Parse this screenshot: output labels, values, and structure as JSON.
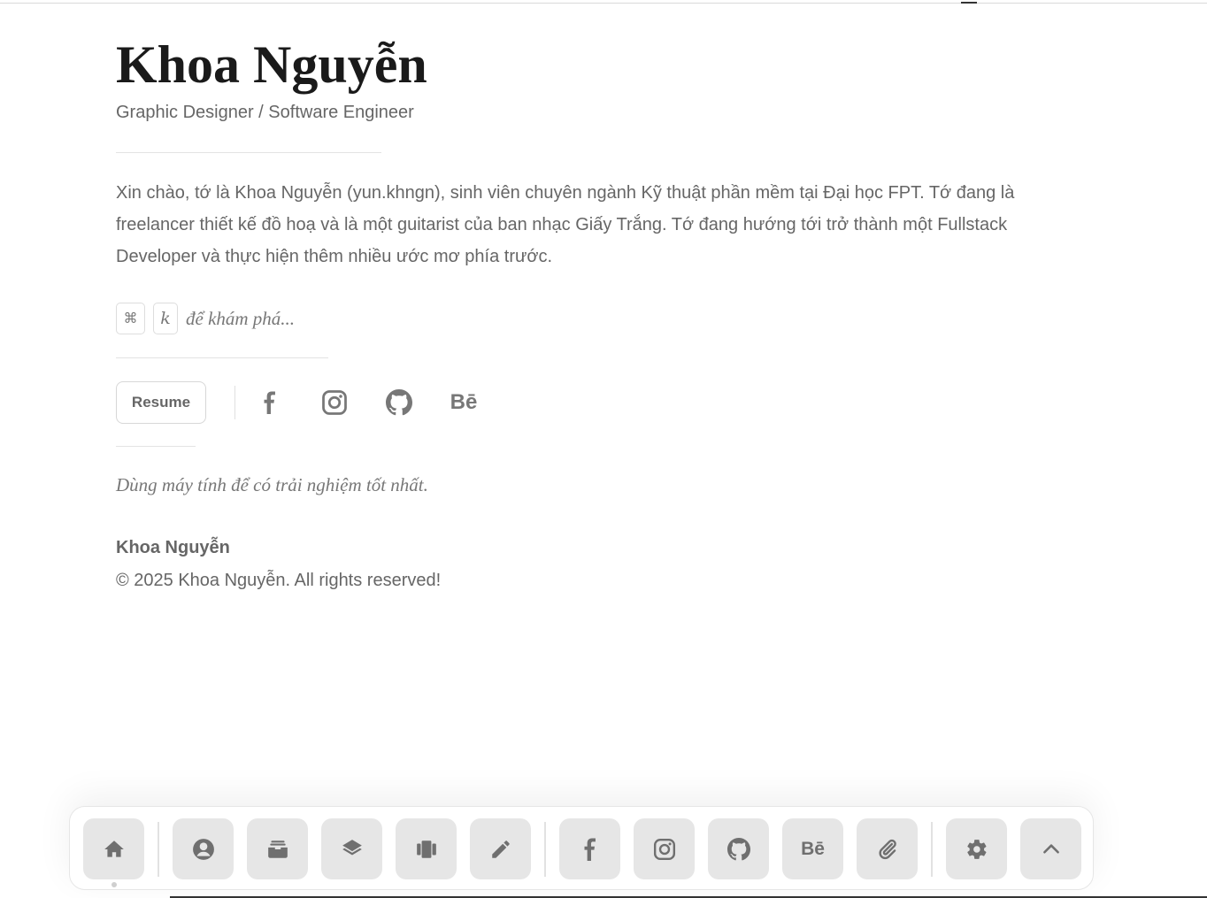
{
  "profile": {
    "name": "Khoa Nguyễn",
    "subtitle": "Graphic Designer / Software Engineer",
    "bio": "Xin chào, tớ là Khoa Nguyễn (yun.khngn), sinh viên chuyên ngành Kỹ thuật phần mềm tại Đại học FPT. Tớ đang là freelancer thiết kế đồ hoạ và là một guitarist của ban nhạc Giấy Trắng. Tớ đang hướng tới trở thành một Fullstack Developer và thực hiện thêm nhiều ước mơ phía trước."
  },
  "shortcut": {
    "key1": "⌘",
    "key2": "k",
    "hint": "để khám phá..."
  },
  "links": {
    "resume_label": "Resume",
    "icons": [
      "facebook-icon",
      "instagram-icon",
      "github-icon",
      "behance-icon"
    ],
    "behance_text": "Bē"
  },
  "note": "Dùng máy tính để có trải nghiệm tốt nhất.",
  "footer": {
    "name": "Khoa Nguyễn",
    "copyright": "© 2025 Khoa Nguyễn. All rights reserved!"
  },
  "dock": {
    "items": [
      "home-icon",
      "profile-icon",
      "archive-icon",
      "layers-icon",
      "gallery-icon",
      "pencil-icon",
      "facebook-icon",
      "instagram-icon",
      "github-icon",
      "behance-icon",
      "paperclip-icon",
      "settings-icon",
      "chevron-up-icon"
    ],
    "behance_text": "Bē",
    "active": "home"
  },
  "colors": {
    "background": "#ffffff",
    "heading": "#1a1a1a",
    "text": "#666666",
    "dock_button": "#e6e6e6"
  }
}
